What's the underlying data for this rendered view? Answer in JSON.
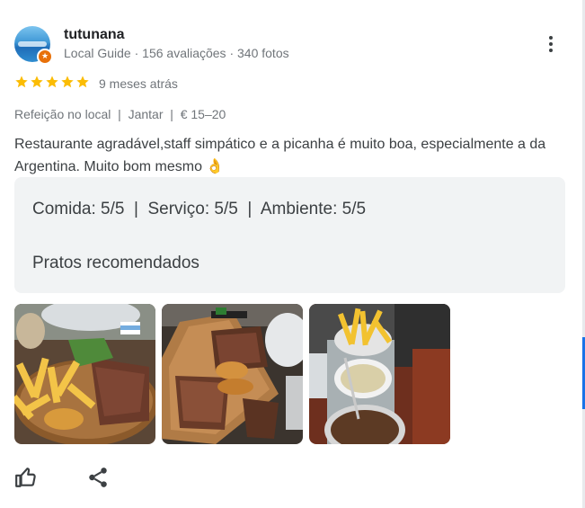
{
  "reviewer": {
    "name": "tutunana",
    "meta": "Local Guide · 156 avaliações · 340 fotos",
    "avatar_icon": "profile-photo-icon",
    "badge_icon": "local-guide-star-icon"
  },
  "rating": {
    "stars": 5,
    "max_stars": 5,
    "star_color": "#fbbc04",
    "date": "9 meses atrás"
  },
  "tags": "Refeição no local  |  Jantar  |  € 15–20",
  "review_text": "Restaurante agradável,staff simpático e a picanha é muito boa, especialmente a da Argentina. Muito bom mesmo 👌",
  "details": {
    "ratings": "Comida: 5/5  |  Serviço: 5/5  |  Ambiente: 5/5",
    "recommended_label": "Pratos recomendados"
  },
  "photos": [
    {
      "name": "photo-steak-fries"
    },
    {
      "name": "photo-grilled-board"
    },
    {
      "name": "photo-fries-rice-beans"
    }
  ],
  "actions": {
    "like_icon": "thumbs-up-icon",
    "share_icon": "share-icon",
    "menu_icon": "more-vert-icon"
  },
  "colors": {
    "panel_bg": "#f1f3f4",
    "meta_text": "#70757a",
    "accent": "#1a73e8"
  }
}
